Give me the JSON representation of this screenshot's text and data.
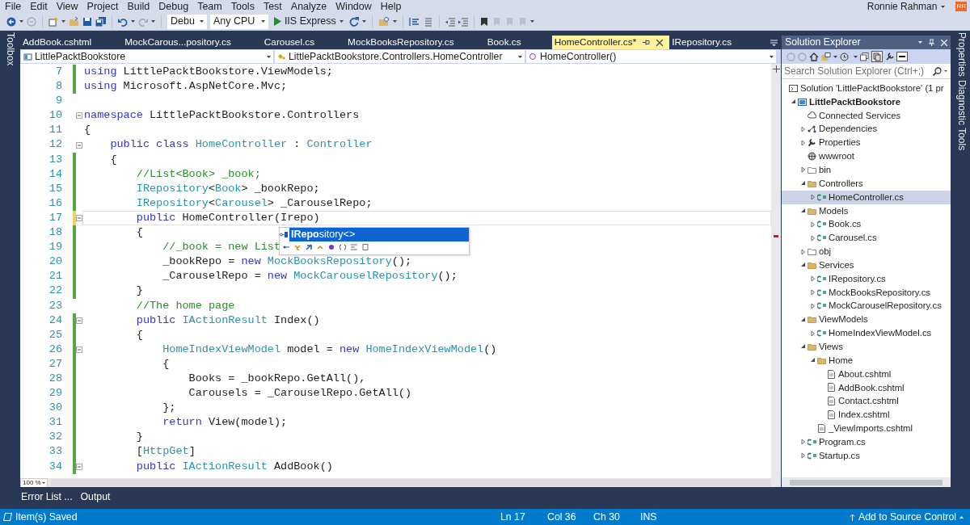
{
  "menu": [
    "File",
    "Edit",
    "View",
    "Project",
    "Build",
    "Debug",
    "Team",
    "Tools",
    "Test",
    "Analyze",
    "Window",
    "Help"
  ],
  "user": {
    "name": "Ronnie Rahman",
    "initials": "RR"
  },
  "toolbar": {
    "configuration": "Debu",
    "platform": "Any CPU",
    "run_target": "IIS Express"
  },
  "left_strip": [
    "Toolbox"
  ],
  "right_strip": [
    "Properties",
    "Diagnostic Tools"
  ],
  "tabs": [
    {
      "label": "AddBook.cshtml",
      "selected": false
    },
    {
      "label": "MockCarous...pository.cs",
      "selected": false
    },
    {
      "label": "Carousel.cs",
      "selected": false
    },
    {
      "label": "MockBooksRepository.cs",
      "selected": false
    },
    {
      "label": "Book.cs",
      "selected": false
    },
    {
      "label": "HomeController.cs*",
      "selected": true
    },
    {
      "label": "IRepository.cs",
      "selected": false
    }
  ],
  "navigation": [
    "LittlePacktBookstore",
    "LittlePacktBookstore.Controllers.HomeController",
    "HomeController()"
  ],
  "editor": {
    "lines": [
      {
        "number": "7",
        "saved_change": true,
        "unsaved_change": false,
        "fold": false,
        "current": false,
        "segments": [
          {
            "kind": "keyword",
            "t": "using"
          },
          {
            "kind": "plain",
            "t": " LittlePacktBookstore.ViewModels;"
          }
        ]
      },
      {
        "number": "8",
        "saved_change": true,
        "unsaved_change": false,
        "fold": false,
        "current": false,
        "segments": [
          {
            "kind": "keyword",
            "t": "using"
          },
          {
            "kind": "plain",
            "t": " Microsoft.AspNetCore.Mvc;"
          }
        ]
      },
      {
        "number": "9",
        "saved_change": false,
        "unsaved_change": false,
        "fold": false,
        "current": false
      },
      {
        "number": "10",
        "saved_change": false,
        "unsaved_change": false,
        "fold": true,
        "current": false,
        "segments": [
          {
            "kind": "keyword",
            "t": "namespace"
          },
          {
            "kind": "plain",
            "t": " LittlePacktBookstore.Controllers"
          }
        ]
      },
      {
        "number": "11",
        "saved_change": false,
        "unsaved_change": false,
        "fold": false,
        "current": false,
        "segments": [
          {
            "kind": "plain",
            "t": "{"
          }
        ]
      },
      {
        "number": "12",
        "saved_change": false,
        "unsaved_change": false,
        "fold": true,
        "current": false,
        "segments": [
          {
            "kind": "keyword",
            "t": "    public class"
          },
          {
            "kind": "type",
            "t": " HomeController"
          },
          {
            "kind": "plain",
            "t": " : "
          },
          {
            "kind": "type",
            "t": "Controller"
          }
        ]
      },
      {
        "number": "13",
        "saved_change": true,
        "unsaved_change": false,
        "fold": false,
        "current": false,
        "segments": [
          {
            "kind": "plain",
            "t": "    {"
          }
        ]
      },
      {
        "number": "14",
        "saved_change": true,
        "unsaved_change": false,
        "fold": false,
        "current": false,
        "segments": [
          {
            "kind": "comment",
            "t": "        //List<Book> _book;"
          }
        ]
      },
      {
        "number": "15",
        "saved_change": true,
        "unsaved_change": false,
        "fold": false,
        "current": false,
        "segments": [
          {
            "kind": "type",
            "t": "        IRepository"
          },
          {
            "kind": "plain",
            "t": "<"
          },
          {
            "kind": "type",
            "t": "Book"
          },
          {
            "kind": "plain",
            "t": "> _bookRepo;"
          }
        ]
      },
      {
        "number": "16",
        "saved_change": true,
        "unsaved_change": false,
        "fold": false,
        "current": false,
        "segments": [
          {
            "kind": "type",
            "t": "        IRepository"
          },
          {
            "kind": "plain",
            "t": "<"
          },
          {
            "kind": "type",
            "t": "Carousel"
          },
          {
            "kind": "plain",
            "t": "> _CarouselRepo;"
          }
        ]
      },
      {
        "number": "17",
        "saved_change": false,
        "unsaved_change": true,
        "fold": true,
        "current": true,
        "segments": [
          {
            "kind": "keyword",
            "t": "        public"
          },
          {
            "kind": "plain",
            "t": " HomeController(Irepo)"
          }
        ]
      },
      {
        "number": "18",
        "saved_change": true,
        "unsaved_change": false,
        "fold": false,
        "current": false,
        "segments": [
          {
            "kind": "plain",
            "t": "        {"
          }
        ]
      },
      {
        "number": "19",
        "saved_change": true,
        "unsaved_change": false,
        "fold": false,
        "current": false,
        "segments": [
          {
            "kind": "comment",
            "t": "            //_book = new List"
          }
        ]
      },
      {
        "number": "20",
        "saved_change": true,
        "unsaved_change": false,
        "fold": false,
        "current": false,
        "segments": [
          {
            "kind": "plain",
            "t": "            _bookRepo = "
          },
          {
            "kind": "keyword",
            "t": "new"
          },
          {
            "kind": "type",
            "t": " MockBooksRepository"
          },
          {
            "kind": "plain",
            "t": "();"
          }
        ]
      },
      {
        "number": "21",
        "saved_change": true,
        "unsaved_change": false,
        "fold": false,
        "current": false,
        "segments": [
          {
            "kind": "plain",
            "t": "            _CarouselRepo = "
          },
          {
            "kind": "keyword",
            "t": "new"
          },
          {
            "kind": "type",
            "t": " MockCarouselRepository"
          },
          {
            "kind": "plain",
            "t": "();"
          }
        ]
      },
      {
        "number": "22",
        "saved_change": true,
        "unsaved_change": false,
        "fold": false,
        "current": false,
        "segments": [
          {
            "kind": "plain",
            "t": "        }"
          }
        ]
      },
      {
        "number": "23",
        "saved_change": false,
        "unsaved_change": false,
        "fold": false,
        "current": false,
        "segments": [
          {
            "kind": "comment",
            "t": "        //The home page"
          }
        ]
      },
      {
        "number": "24",
        "saved_change": true,
        "unsaved_change": false,
        "fold": true,
        "current": false,
        "segments": [
          {
            "kind": "keyword",
            "t": "        public"
          },
          {
            "kind": "type",
            "t": " IActionResult"
          },
          {
            "kind": "plain",
            "t": " Index()"
          }
        ]
      },
      {
        "number": "25",
        "saved_change": true,
        "unsaved_change": false,
        "fold": false,
        "current": false,
        "segments": [
          {
            "kind": "plain",
            "t": "        {"
          }
        ]
      },
      {
        "number": "26",
        "saved_change": true,
        "unsaved_change": false,
        "fold": true,
        "current": false,
        "segments": [
          {
            "kind": "type",
            "t": "            HomeIndexViewModel"
          },
          {
            "kind": "plain",
            "t": " model = "
          },
          {
            "kind": "keyword",
            "t": "new"
          },
          {
            "kind": "type",
            "t": " HomeIndexViewModel"
          },
          {
            "kind": "plain",
            "t": "()"
          }
        ]
      },
      {
        "number": "27",
        "saved_change": true,
        "unsaved_change": false,
        "fold": false,
        "current": false,
        "segments": [
          {
            "kind": "plain",
            "t": "            {"
          }
        ]
      },
      {
        "number": "28",
        "saved_change": true,
        "unsaved_change": false,
        "fold": false,
        "current": false,
        "segments": [
          {
            "kind": "plain",
            "t": "                Books = _bookRepo.GetAll(),"
          }
        ]
      },
      {
        "number": "29",
        "saved_change": true,
        "unsaved_change": false,
        "fold": false,
        "current": false,
        "segments": [
          {
            "kind": "plain",
            "t": "                Carousels = _CarouselRepo.GetAll()"
          }
        ]
      },
      {
        "number": "30",
        "saved_change": true,
        "unsaved_change": false,
        "fold": false,
        "current": false,
        "segments": [
          {
            "kind": "plain",
            "t": "            };"
          }
        ]
      },
      {
        "number": "31",
        "saved_change": true,
        "unsaved_change": false,
        "fold": false,
        "current": false,
        "segments": [
          {
            "kind": "keyword",
            "t": "            return"
          },
          {
            "kind": "plain",
            "t": " View(model);"
          }
        ]
      },
      {
        "number": "32",
        "saved_change": true,
        "unsaved_change": false,
        "fold": false,
        "current": false,
        "segments": [
          {
            "kind": "plain",
            "t": "        }"
          }
        ]
      },
      {
        "number": "33",
        "saved_change": true,
        "unsaved_change": false,
        "fold": false,
        "current": false,
        "segments": [
          {
            "kind": "plain",
            "t": "        ["
          },
          {
            "kind": "type",
            "t": "HttpGet"
          },
          {
            "kind": "plain",
            "t": "]"
          }
        ]
      },
      {
        "number": "34",
        "saved_change": true,
        "unsaved_change": false,
        "fold": true,
        "current": false,
        "segments": [
          {
            "kind": "keyword",
            "t": "        public"
          },
          {
            "kind": "type",
            "t": " IActionResult"
          },
          {
            "kind": "plain",
            "t": " AddBook()"
          }
        ]
      }
    ],
    "completion": {
      "items": [
        {
          "text": "**IRepo**sitory<>",
          "selected": true
        }
      ]
    },
    "zoom": "100 %"
  },
  "solution_explorer": {
    "title": "Solution Explorer",
    "search": {
      "placeholder": "Search Solution Explorer (Ctrl+;)"
    },
    "tree": [
      {
        "label": "Solution 'LittlePacktBookstore' (1 pr",
        "kind": "solution",
        "selected": false,
        "children": [
          {
            "label": "LittlePacktBookstore",
            "kind": "project",
            "expandable": true,
            "expanded": true,
            "selected": false,
            "children": [
              {
                "label": "Connected Services",
                "kind": "cloud",
                "expandable": false,
                "selected": false
              },
              {
                "label": "Dependencies",
                "kind": "dependencies",
                "expandable": true,
                "expanded": false,
                "selected": false
              },
              {
                "label": "Properties",
                "kind": "wrench",
                "expandable": true,
                "expanded": false,
                "selected": false
              },
              {
                "label": "wwwroot",
                "kind": "globe",
                "expandable": false,
                "selected": false
              },
              {
                "label": "bin",
                "kind": "folder-empty",
                "expandable": true,
                "expanded": false,
                "selected": false
              },
              {
                "label": "Controllers",
                "kind": "folder",
                "expandable": true,
                "expanded": true,
                "selected": false,
                "children": [
                  {
                    "label": "HomeController.cs",
                    "kind": "csharp",
                    "expandable": true,
                    "expanded": false,
                    "selected": true
                  }
                ]
              },
              {
                "label": "Models",
                "kind": "folder",
                "expandable": true,
                "expanded": true,
                "selected": false,
                "children": [
                  {
                    "label": "Book.cs",
                    "kind": "csharp",
                    "expandable": true,
                    "expanded": false,
                    "selected": false
                  },
                  {
                    "label": "Carousel.cs",
                    "kind": "csharp",
                    "expandable": true,
                    "expanded": false,
                    "selected": false
                  }
                ]
              },
              {
                "label": "obj",
                "kind": "folder-empty",
                "expandable": true,
                "expanded": false,
                "selected": false
              },
              {
                "label": "Services",
                "kind": "folder",
                "expandable": true,
                "expanded": true,
                "selected": false,
                "children": [
                  {
                    "label": "IRepository.cs",
                    "kind": "csharp",
                    "expandable": true,
                    "expanded": false,
                    "selected": false
                  },
                  {
                    "label": "MockBooksRepository.cs",
                    "kind": "csharp",
                    "expandable": true,
                    "expanded": false,
                    "selected": false
                  },
                  {
                    "label": "MockCarouselRepository.cs",
                    "kind": "csharp",
                    "expandable": true,
                    "expanded": false,
                    "selected": false
                  }
                ]
              },
              {
                "label": "ViewModels",
                "kind": "folder",
                "expandable": true,
                "expanded": true,
                "selected": false,
                "children": [
                  {
                    "label": "HomeIndexViewModel.cs",
                    "kind": "csharp",
                    "expandable": true,
                    "expanded": false,
                    "selected": false
                  }
                ]
              },
              {
                "label": "Views",
                "kind": "folder",
                "expandable": true,
                "expanded": true,
                "selected": false,
                "children": [
                  {
                    "label": "Home",
                    "kind": "folder",
                    "expandable": true,
                    "expanded": true,
                    "selected": false,
                    "children": [
                      {
                        "label": "About.cshtml",
                        "kind": "page",
                        "expandable": false,
                        "selected": false
                      },
                      {
                        "label": "AddBook.cshtml",
                        "kind": "page",
                        "expandable": false,
                        "selected": false
                      },
                      {
                        "label": "Contact.cshtml",
                        "kind": "page",
                        "expandable": false,
                        "selected": false
                      },
                      {
                        "label": "Index.cshtml",
                        "kind": "page",
                        "expandable": false,
                        "selected": false
                      }
                    ]
                  },
                  {
                    "label": "_ViewImports.cshtml",
                    "kind": "page",
                    "expandable": false,
                    "selected": false
                  }
                ]
              },
              {
                "label": "Program.cs",
                "kind": "csharp",
                "expandable": true,
                "expanded": false,
                "selected": false
              },
              {
                "label": "Startup.cs",
                "kind": "csharp",
                "expandable": true,
                "expanded": false,
                "selected": false
              }
            ]
          }
        ]
      }
    ]
  },
  "bottom_tabs": [
    {
      "label": "Error List ...",
      "selected": false
    },
    {
      "label": "Output",
      "selected": false
    }
  ],
  "status_bar": {
    "message": "Item(s) Saved",
    "cells": [
      "Ln 17",
      "Col 36",
      "Ch 30",
      "INS"
    ],
    "source_control": "Add to Source Control"
  }
}
